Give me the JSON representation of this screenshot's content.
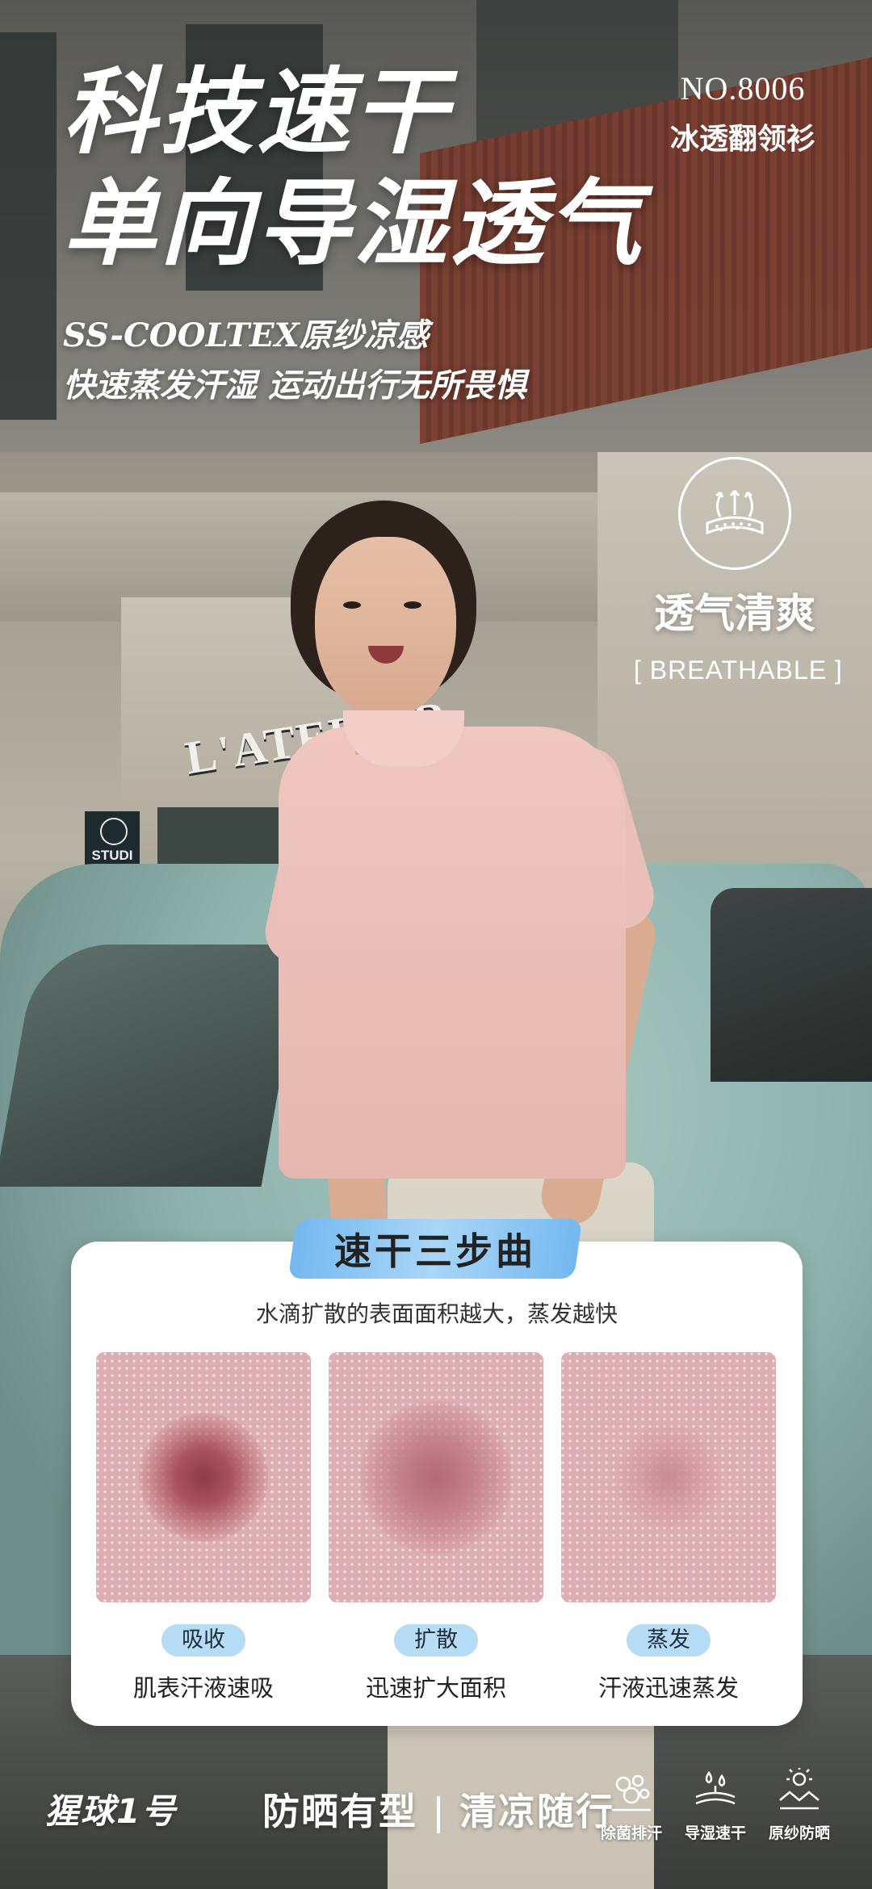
{
  "headline": {
    "line1": "科技速干",
    "line2": "单向导湿透气"
  },
  "subline": {
    "line1": "SS-COOLTEX原纱凉感",
    "line2": "快速蒸发汗湿 运动出行无所畏惧"
  },
  "model": {
    "code": "NO.8006",
    "name": "冰透翻领衫"
  },
  "badge": {
    "icon": "breathable-fabric-icon",
    "title": "透气清爽",
    "subtitle": "[  BREATHABLE  ]"
  },
  "scene": {
    "shop_sign": "L'ATELIER",
    "studio_sign": "STUDIO PIVOTE"
  },
  "card": {
    "title": "速干三步曲",
    "description": "水滴扩散的表面面积越大，蒸发越快",
    "steps": [
      {
        "label": "吸收",
        "desc": "肌表汗液速吸"
      },
      {
        "label": "扩散",
        "desc": "迅速扩大面积"
      },
      {
        "label": "蒸发",
        "desc": "汗液迅速蒸发"
      }
    ]
  },
  "footer": {
    "brand": "猩球1号",
    "slogan_left": "防晒有型",
    "slogan_right": "清凉随行",
    "features": [
      {
        "icon": "antibacterial-icon",
        "label": "除菌排汗"
      },
      {
        "icon": "moisture-wicking-icon",
        "label": "导湿速干"
      },
      {
        "icon": "sun-protection-icon",
        "label": "原纱防晒"
      }
    ]
  },
  "colors": {
    "accent_blue": "#74b8ef",
    "pill_blue": "#b6dcf6",
    "shirt_pink": "#efc6c0",
    "card_bg": "#ffffff"
  }
}
